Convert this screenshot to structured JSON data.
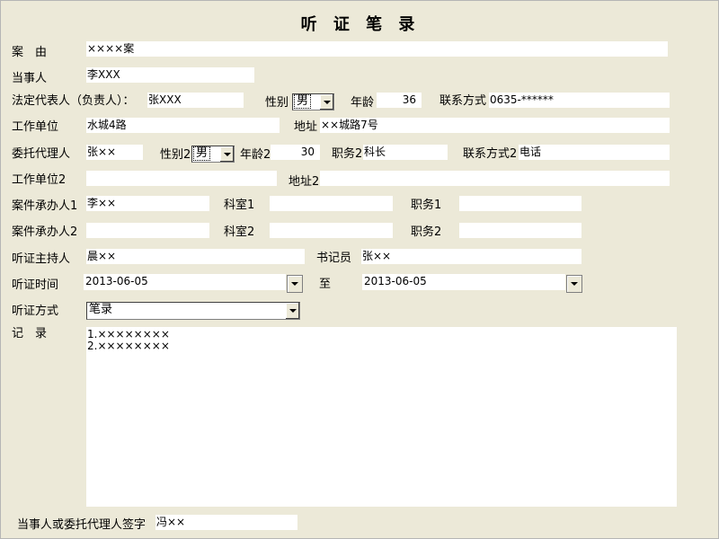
{
  "title": "听 证 笔 录",
  "case": {
    "label": "案　由",
    "value": "××××案"
  },
  "party": {
    "label": "当事人",
    "value": "李XXX"
  },
  "legal_rep": {
    "label": "法定代表人（负责人）：",
    "value": "张XXX",
    "sex_label": "性别",
    "sex_value": "男",
    "age_label": "年龄",
    "age_value": "36",
    "contact_label": "联系方式",
    "contact_value": "0635-******"
  },
  "work_unit": {
    "label": "工作单位",
    "value": "水城4路",
    "address_label": "地址",
    "address_value": "××城路7号"
  },
  "agent": {
    "label": "委托代理人",
    "value": "张××",
    "sex_label": "性别2",
    "sex_value": "男",
    "age_label": "年龄2",
    "age_value": "30",
    "position_label": "职务2",
    "position_value": "科长",
    "contact_label": "联系方式2",
    "contact_value": "电话"
  },
  "work_unit2": {
    "label": "工作单位2",
    "value": "",
    "address_label": "地址2",
    "address_value": ""
  },
  "handler1": {
    "label": "案件承办人1",
    "value": "李××",
    "dept_label": "科室1",
    "dept_value": "",
    "position_label": "职务1",
    "position_value": ""
  },
  "handler2": {
    "label": "案件承办人2",
    "value": "",
    "dept_label": "科室2",
    "dept_value": "",
    "position_label": "职务2",
    "position_value": ""
  },
  "host": {
    "label": "听证主持人",
    "value": "晨××",
    "clerk_label": "书记员",
    "clerk_value": "张××"
  },
  "hearing_time": {
    "label": "听证时间",
    "from_value": "2013-06-05",
    "to_label": "至",
    "to_value": "2013-06-05"
  },
  "hearing_mode": {
    "label": "听证方式",
    "value": "笔录"
  },
  "record": {
    "label": "记　录",
    "lines": "1.××××××××\n2.××××××××"
  },
  "signature": {
    "label": "当事人或委托代理人签字",
    "value": "冯××"
  }
}
